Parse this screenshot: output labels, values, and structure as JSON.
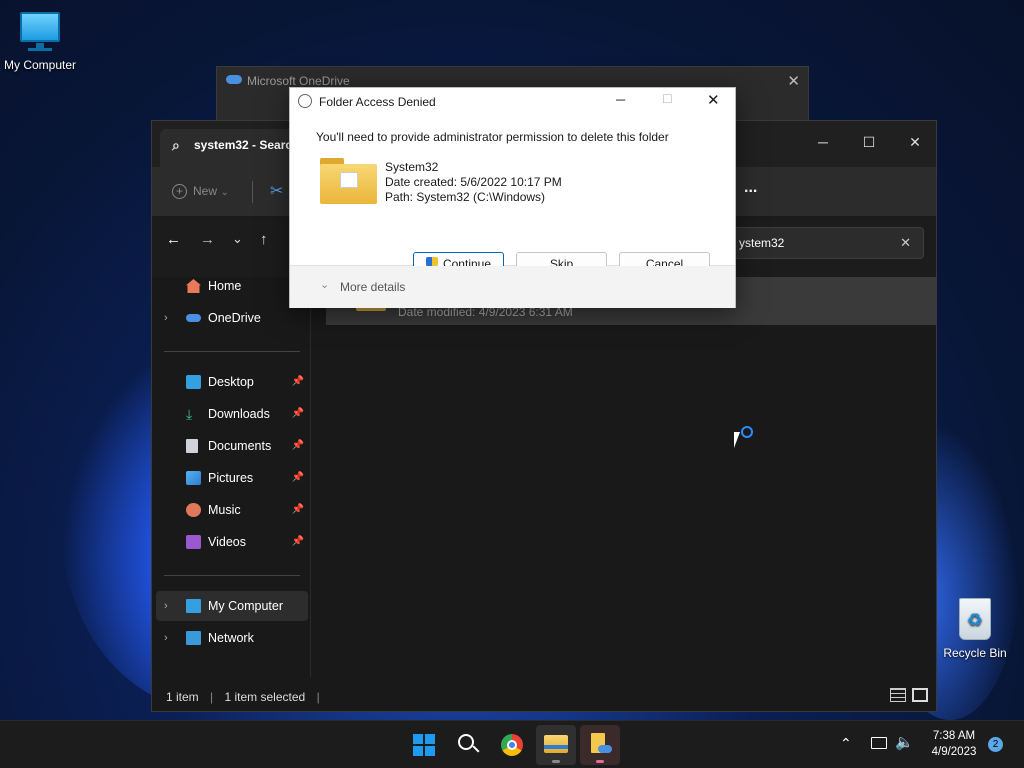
{
  "desktop": {
    "icons": [
      {
        "label": "My Computer",
        "icon": "monitor-icon"
      },
      {
        "label": "Recycle Bin",
        "icon": "recycle-bin-icon"
      }
    ]
  },
  "onedrive_window": {
    "title": "Microsoft OneDrive"
  },
  "explorer": {
    "tab_title": "system32 - Search",
    "toolbar": {
      "new_label": "New",
      "more_label": "..."
    },
    "search_value": "ystem32",
    "nav": {
      "home": "Home",
      "onedrive": "OneDrive",
      "desktop": "Desktop",
      "downloads": "Downloads",
      "documents": "Documents",
      "pictures": "Pictures",
      "music": "Music",
      "videos": "Videos",
      "my_computer": "My Computer",
      "network": "Network"
    },
    "row_subtitle": "Date modified: 4/9/2023 6:31 AM",
    "status": {
      "count": "1 item",
      "selected": "1 item selected"
    }
  },
  "dialog": {
    "title": "Folder Access Denied",
    "message": "You'll need to provide administrator permission to delete this folder",
    "folder_name": "System32",
    "date_created": "Date created: 5/6/2022 10:17 PM",
    "path": "Path: System32 (C:\\Windows)",
    "continue_label": "Continue",
    "skip_label": "Skip",
    "cancel_label": "Cancel",
    "more_details": "More details"
  },
  "taskbar": {
    "time": "7:38 AM",
    "date": "4/9/2023",
    "notification_count": "2"
  },
  "colors": {
    "accent": "#0067c0",
    "folder": "#f4c542",
    "taskbar": "#1c1c1c"
  }
}
